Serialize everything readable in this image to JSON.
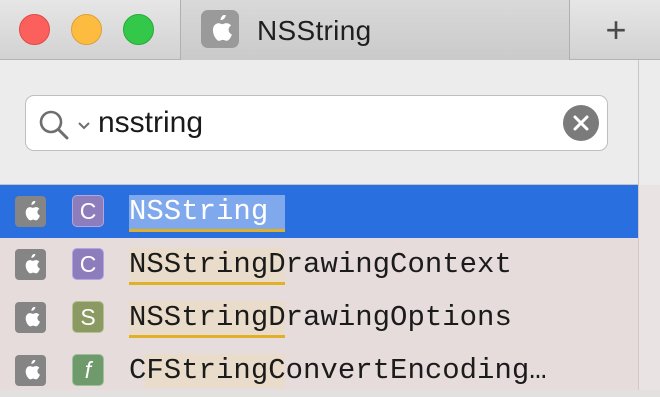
{
  "window": {
    "tab_title": "NSString",
    "tab_icon": "apple-icon",
    "new_tab_label": "+"
  },
  "search": {
    "query": "nsstring",
    "icon": "search-icon",
    "clear_icon": "clear-icon"
  },
  "results": [
    {
      "name": "NSString",
      "kind_letter": "C",
      "kind_color": "#8e7dbc",
      "selected": true
    },
    {
      "name": "NSStringDrawingContext",
      "kind_letter": "C",
      "kind_color": "#8e7dbc",
      "selected": false
    },
    {
      "name": "NSStringDrawingOptions",
      "kind_letter": "S",
      "kind_color": "#8b9a62",
      "selected": false
    },
    {
      "name": "CFStringConvertEncoding…",
      "kind_letter": "f",
      "kind_color": "#6f9a6b",
      "selected": false
    }
  ],
  "colors": {
    "selection": "#2a6fe0",
    "match_underline": "#e2b027",
    "close": "#fc605c",
    "minimize": "#fdbc40",
    "zoom": "#34c84a"
  }
}
